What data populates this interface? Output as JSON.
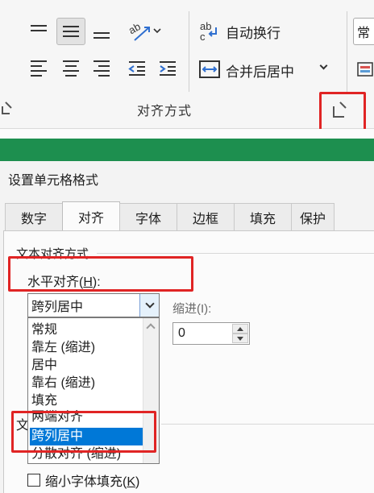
{
  "ribbon": {
    "wrap_text_label": "自动换行",
    "merge_center_label": "合并后居中",
    "group_label": "对齐方式",
    "right_partial_label": "常",
    "icons": [
      "align-top-icon",
      "align-middle-icon",
      "align-bottom-icon",
      "orientation-icon",
      "align-left-icon",
      "align-center-icon",
      "align-right-icon",
      "decrease-indent-icon",
      "increase-indent-icon",
      "wrap-text-icon",
      "merge-center-icon",
      "dialog-launcher-icon"
    ]
  },
  "dialog": {
    "title": "设置单元格格式",
    "tabs": [
      "数字",
      "对齐",
      "字体",
      "边框",
      "填充",
      "保护"
    ],
    "active_tab": "对齐",
    "text_alignment_section": "文本对齐方式",
    "horizontal_label": "水平对齐(",
    "horizontal_key": "H",
    "horizontal_suffix": "):",
    "horizontal_value": "跨列居中",
    "indent_label": "缩进(I):",
    "indent_value": "0",
    "dropdown_options": [
      "常规",
      "靠左 (缩进)",
      "居中",
      "靠右 (缩进)",
      "填充",
      "两端对齐",
      "跨列居中",
      "分散对齐 (缩进)"
    ],
    "selected_option": "跨列居中",
    "text_control_prefix": "文",
    "shrink_label": "缩小字体填充(",
    "shrink_key": "K",
    "shrink_suffix": ")"
  },
  "colors": {
    "accent_green": "#1d8f4f",
    "highlight_red": "#e02424",
    "selection_blue": "#0078d7"
  }
}
